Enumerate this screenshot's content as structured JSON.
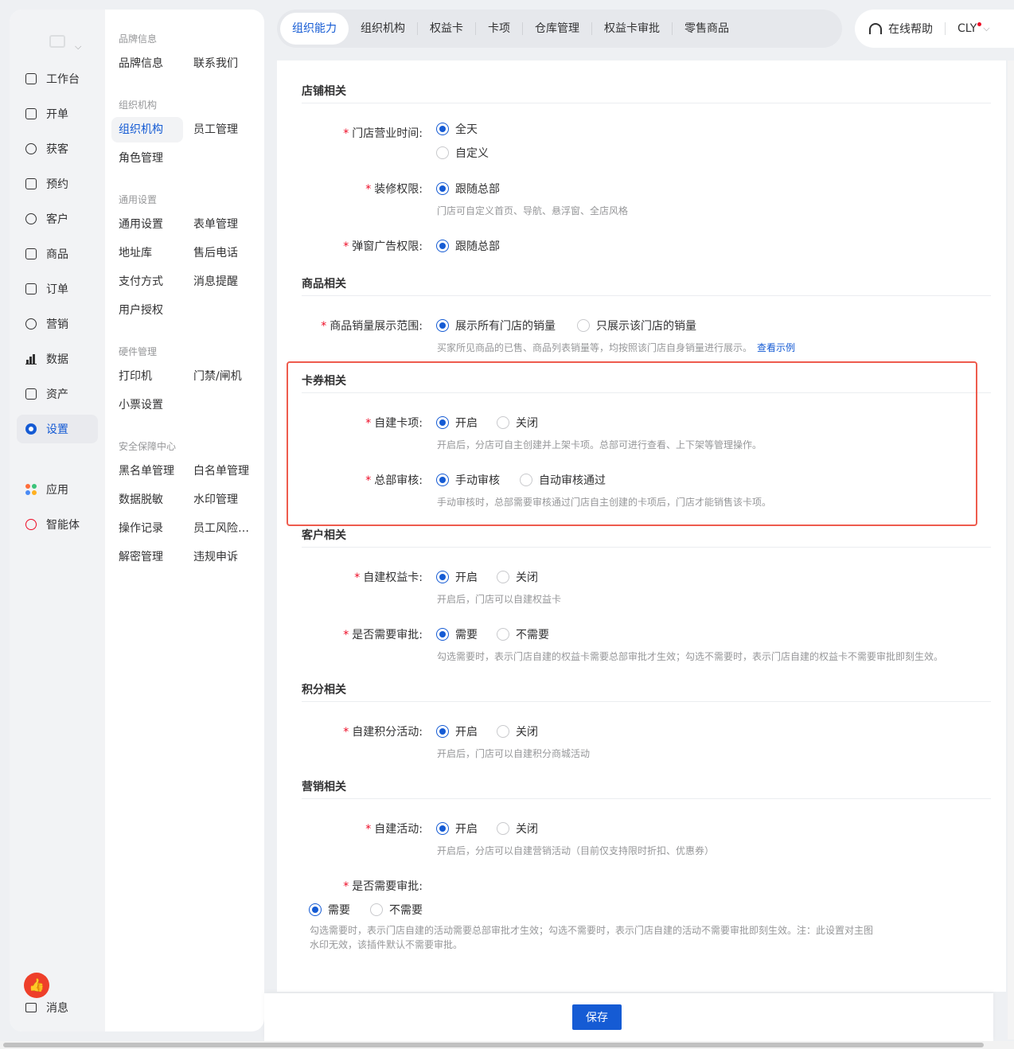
{
  "primary_nav": {
    "items": [
      {
        "label": "工作台",
        "icon": "workbench-icon"
      },
      {
        "label": "开单",
        "icon": "order-create-icon"
      },
      {
        "label": "获客",
        "icon": "acquire-icon"
      },
      {
        "label": "预约",
        "icon": "calendar-icon"
      },
      {
        "label": "客户",
        "icon": "user-icon"
      },
      {
        "label": "商品",
        "icon": "bag-icon"
      },
      {
        "label": "订单",
        "icon": "document-icon"
      },
      {
        "label": "营销",
        "icon": "target-icon"
      },
      {
        "label": "数据",
        "icon": "bar-chart-icon"
      },
      {
        "label": "资产",
        "icon": "asset-icon"
      },
      {
        "label": "设置",
        "icon": "gear-icon"
      },
      {
        "label": "应用",
        "icon": "apps-icon"
      },
      {
        "label": "智能体",
        "icon": "agent-icon"
      }
    ],
    "active": "设置",
    "message_label": "消息"
  },
  "secondary_nav": {
    "groups": [
      {
        "title": "品牌信息",
        "items": [
          "品牌信息",
          "联系我们"
        ]
      },
      {
        "title": "组织机构",
        "items": [
          "组织机构",
          "员工管理",
          "角色管理"
        ]
      },
      {
        "title": "通用设置",
        "items": [
          "通用设置",
          "表单管理",
          "地址库",
          "售后电话",
          "支付方式",
          "消息提醒",
          "用户授权"
        ]
      },
      {
        "title": "硬件管理",
        "items": [
          "打印机",
          "门禁/闸机",
          "小票设置"
        ]
      },
      {
        "title": "安全保障中心",
        "items": [
          "黑名单管理",
          "白名单管理",
          "数据脱敏",
          "水印管理",
          "操作记录",
          "员工风险监控",
          "解密管理",
          "违规申诉"
        ]
      }
    ],
    "active": "组织机构"
  },
  "tabs": [
    "组织能力",
    "组织机构",
    "权益卡",
    "卡项",
    "仓库管理",
    "权益卡审批",
    "零售商品"
  ],
  "active_tab": "组织能力",
  "header": {
    "help_label": "在线帮助",
    "user_label": "CLY"
  },
  "sections": {
    "store": {
      "title": "店铺相关",
      "hours": {
        "label": "门店营业时间:",
        "options": [
          "全天",
          "自定义"
        ],
        "selected": "全天"
      },
      "decor": {
        "label": "装修权限:",
        "options": [
          "跟随总部"
        ],
        "selected": "跟随总部",
        "hint": "门店可自定义首页、导航、悬浮窗、全店风格"
      },
      "popup": {
        "label": "弹窗广告权限:",
        "options": [
          "跟随总部"
        ],
        "selected": "跟随总部"
      }
    },
    "goods": {
      "title": "商品相关",
      "sales": {
        "label": "商品销量展示范围:",
        "options": [
          "展示所有门店的销量",
          "只展示该门店的销量"
        ],
        "selected": "展示所有门店的销量",
        "hint": "买家所见商品的已售、商品列表销量等，均按照该门店自身销量进行展示。",
        "link": "查看示例"
      }
    },
    "card": {
      "title": "卡券相关",
      "self_card": {
        "label": "自建卡项:",
        "options": [
          "开启",
          "关闭"
        ],
        "selected": "开启",
        "hint": "开启后，分店可自主创建并上架卡项。总部可进行查看、上下架等管理操作。"
      },
      "hq_review": {
        "label": "总部审核:",
        "options": [
          "手动审核",
          "自动审核通过"
        ],
        "selected": "手动审核",
        "hint": "手动审核时，总部需要审核通过门店自主创建的卡项后，门店才能销售该卡项。"
      }
    },
    "customer": {
      "title": "客户相关",
      "self_benefit": {
        "label": "自建权益卡:",
        "options": [
          "开启",
          "关闭"
        ],
        "selected": "开启",
        "hint": "开启后，门店可以自建权益卡"
      },
      "approval": {
        "label": "是否需要审批:",
        "options": [
          "需要",
          "不需要"
        ],
        "selected": "需要",
        "hint": "勾选需要时，表示门店自建的权益卡需要总部审批才生效；勾选不需要时，表示门店自建的权益卡不需要审批即刻生效。"
      }
    },
    "points": {
      "title": "积分相关",
      "self_points": {
        "label": "自建积分活动:",
        "options": [
          "开启",
          "关闭"
        ],
        "selected": "开启",
        "hint": "开启后，门店可以自建积分商城活动"
      }
    },
    "marketing": {
      "title": "营销相关",
      "self_activity": {
        "label": "自建活动:",
        "options": [
          "开启",
          "关闭"
        ],
        "selected": "开启",
        "hint": "开启后，分店可以自建营销活动（目前仅支持限时折扣、优惠券）"
      },
      "approval": {
        "label": "是否需要审批:",
        "options": [
          "需要",
          "不需要"
        ],
        "selected": "需要",
        "hint": "勾选需要时，表示门店自建的活动需要总部审批才生效；勾选不需要时，表示门店自建的活动不需要审批即刻生效。注：此设置对主图水印无效，该插件默认不需要审批。"
      }
    }
  },
  "save_label": "保存",
  "colors": {
    "primary": "#155bd4",
    "required": "#ee0a24",
    "highlight": "#ee5b4d"
  }
}
